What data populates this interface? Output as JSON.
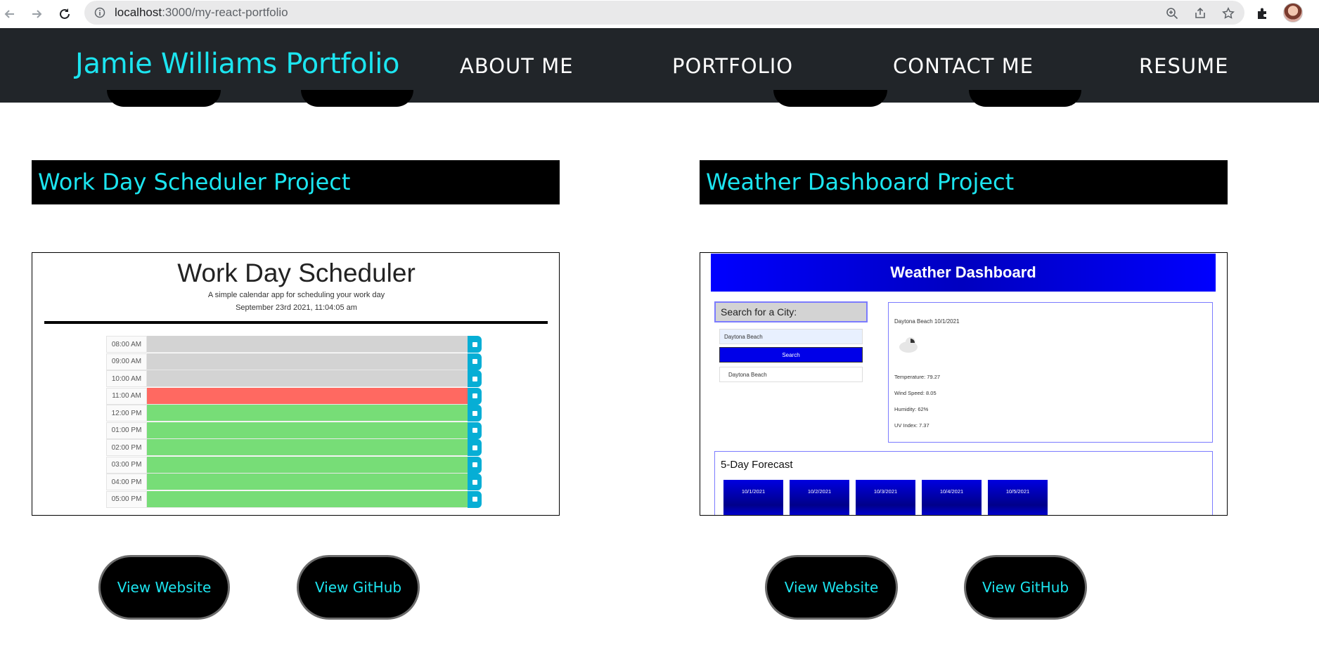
{
  "browser": {
    "url_host": "localhost",
    "url_path": ":3000/my-react-portfolio"
  },
  "header": {
    "brand": "Jamie Williams Portfolio",
    "nav": [
      "ABOUT ME",
      "PORTFOLIO",
      "CONTACT ME",
      "RESUME"
    ]
  },
  "projects": [
    {
      "title": "Work Day Scheduler Project",
      "website_label": "View Website",
      "github_label": "View GitHub",
      "preview": {
        "title": "Work Day Scheduler",
        "subtitle": "A simple calendar app for scheduling your work day",
        "date": "September 23rd 2021, 11:04:05 am",
        "hours": [
          "08:00 AM",
          "09:00 AM",
          "10:00 AM",
          "11:00 AM",
          "12:00 PM",
          "01:00 PM",
          "02:00 PM",
          "03:00 PM",
          "04:00 PM",
          "05:00 PM"
        ],
        "states": [
          "past",
          "past",
          "past",
          "present",
          "future",
          "future",
          "future",
          "future",
          "future",
          "future"
        ],
        "colors": {
          "past": "#d3d3d3",
          "present": "#ff6961",
          "future": "#77dd77"
        }
      }
    },
    {
      "title": "Weather Dashboard Project",
      "website_label": "View Website",
      "github_label": "View GitHub",
      "preview": {
        "title": "Weather Dashboard",
        "search_label": "Search for a City:",
        "input_value": "Daytona Beach",
        "search_button": "Search",
        "history_item": "Daytona Beach",
        "current_city": "Daytona Beach 10/1/2021",
        "temperature": "Temperature: 79.27",
        "wind": "Wind Speed: 8.05",
        "humidity": "Humidity: 62%",
        "uv": "UV Index: 7.37",
        "forecast_title": "5-Day Forecast",
        "forecast_days": [
          "10/1/2021",
          "10/2/2021",
          "10/3/2021",
          "10/4/2021",
          "10/5/2021"
        ]
      }
    }
  ],
  "colors": {
    "accent": "#1ce5f0",
    "header_bg": "#212529",
    "card_bg": "#000000"
  }
}
